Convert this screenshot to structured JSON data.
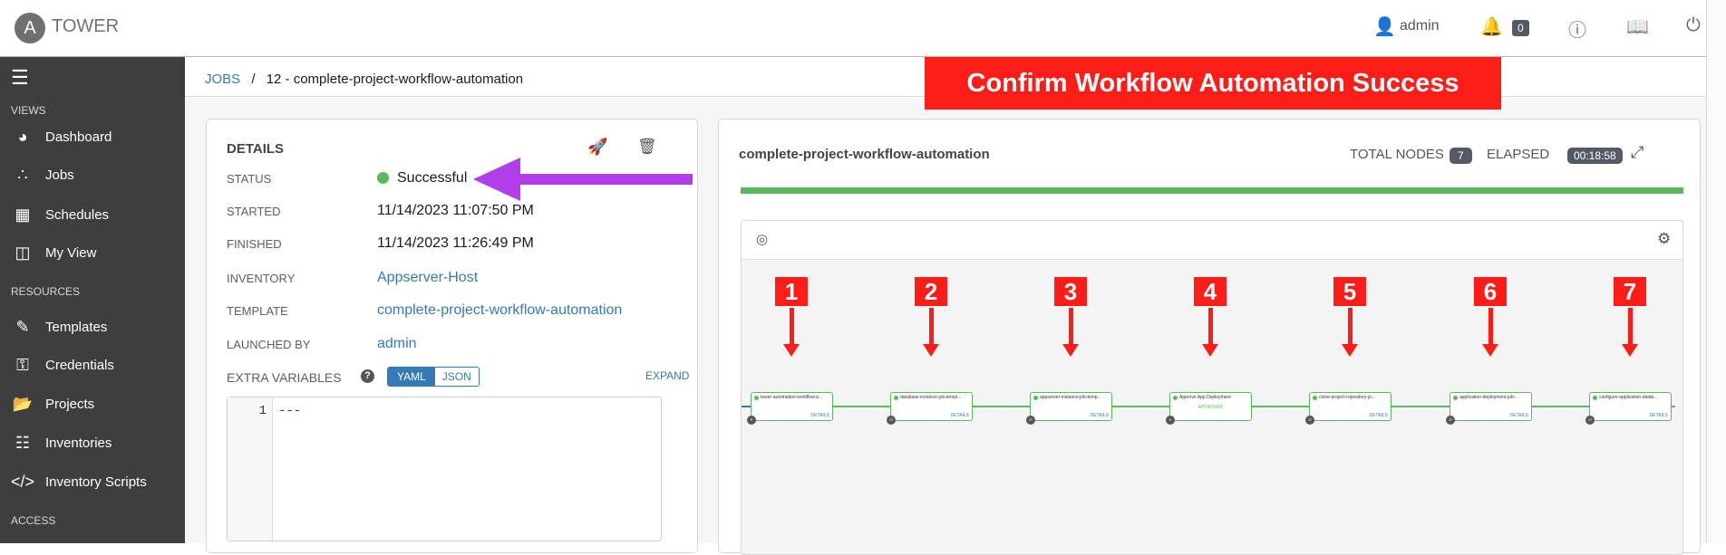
{
  "header": {
    "brand": "TOWER",
    "user": "admin",
    "notifications": "0"
  },
  "sidebar": {
    "sections": [
      "VIEWS",
      "RESOURCES",
      "ACCESS"
    ],
    "items": [
      {
        "label": "Dashboard",
        "icon": "dashboard-icon"
      },
      {
        "label": "Jobs",
        "icon": "jobs-icon"
      },
      {
        "label": "Schedules",
        "icon": "calendar-icon"
      },
      {
        "label": "My View",
        "icon": "columns-icon"
      },
      {
        "label": "Templates",
        "icon": "pencil-icon"
      },
      {
        "label": "Credentials",
        "icon": "key-icon"
      },
      {
        "label": "Projects",
        "icon": "folder-icon"
      },
      {
        "label": "Inventories",
        "icon": "sitemap-icon"
      },
      {
        "label": "Inventory Scripts",
        "icon": "code-icon"
      }
    ]
  },
  "breadcrumb": {
    "root": "JOBS",
    "sep": "/",
    "current": "12 - complete-project-workflow-automation"
  },
  "banner": "Confirm Workflow Automation Success",
  "details": {
    "title": "DETAILS",
    "rows": [
      {
        "label": "STATUS",
        "value": "Successful"
      },
      {
        "label": "STARTED",
        "value": "11/14/2023 11:07:50 PM"
      },
      {
        "label": "FINISHED",
        "value": "11/14/2023 11:26:49 PM"
      },
      {
        "label": "INVENTORY",
        "value": "Appserver-Host"
      },
      {
        "label": "TEMPLATE",
        "value": "complete-project-workflow-automation"
      },
      {
        "label": "LAUNCHED BY",
        "value": "admin"
      }
    ],
    "extra_vars_label": "EXTRA VARIABLES",
    "yaml": "YAML",
    "json": "JSON",
    "expand": "EXPAND",
    "line_no": "1",
    "code": "---"
  },
  "workflow": {
    "title": "complete-project-workflow-automation",
    "total_nodes_label": "TOTAL NODES",
    "total_nodes": "7",
    "elapsed_label": "ELAPSED",
    "elapsed": "00:18:58",
    "progress": 1.0,
    "nodes": [
      {
        "marker": "1",
        "name": "tower-automation-workflow-p...",
        "type": "P",
        "link": "DETAILS"
      },
      {
        "marker": "2",
        "name": "database-instance-job-templ...",
        "type": "JT",
        "link": "DETAILS"
      },
      {
        "marker": "3",
        "name": "appserver-instance-job-temp...",
        "type": "JT",
        "link": "DETAILS"
      },
      {
        "marker": "4",
        "name": "Approve App Deployment",
        "type": "II",
        "status": "APPROVED"
      },
      {
        "marker": "5",
        "name": "clone-project-repository-jo...",
        "type": "JT",
        "link": "DETAILS"
      },
      {
        "marker": "6",
        "name": "application-deployment-job-...",
        "type": "JT",
        "link": "DETAILS"
      },
      {
        "marker": "7",
        "name": "configure-application-datab...",
        "type": "JT",
        "link": "DETAILS"
      }
    ]
  }
}
